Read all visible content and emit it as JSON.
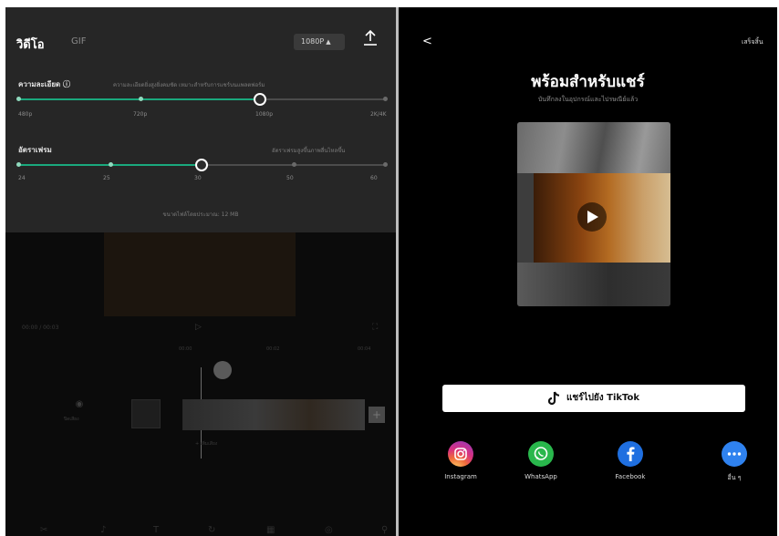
{
  "left": {
    "tabs": {
      "video": "วิดีโอ",
      "gif": "GIF"
    },
    "resolution_select": "1080P",
    "resolution_section": {
      "label": "ความละเอียด ⓘ",
      "hint": "ความละเอียดยิ่งสูงยิ่งคมชัด เหมาะสำหรับการแชร์บนแพลตฟอร์ม",
      "ticks": [
        "480p",
        "720p",
        "1080p",
        "2K/4K"
      ],
      "selected_fraction": 0.66
    },
    "framerate_section": {
      "label": "อัตราเฟรม",
      "hint": "อัตราเฟรมสูงขึ้นภาพลื่นไหลขึ้น",
      "ticks": [
        "24",
        "25",
        "30",
        "50",
        "60"
      ],
      "selected_fraction": 0.5
    },
    "size_note": "ขนาดไฟล์โดยประมาณ: 12 MB",
    "editor": {
      "time": "00:00 / 00:03",
      "ruler": [
        "00:00",
        "00:02",
        "00:04"
      ],
      "mute_label": "ปิดเสียง",
      "audio_label": "+ เพิ่มเสียง"
    }
  },
  "right": {
    "back": "<",
    "done": "เสร็จสิ้น",
    "title": "พร้อมสำหรับแชร์",
    "subtitle": "บันทึกลงในอุปกรณ์และไปรษณีย์แล้ว",
    "tiktok_button": "แชร์ไปยัง TikTok",
    "share_targets": [
      {
        "label": "Instagram",
        "icon": "instagram-icon",
        "color": "#d8317f"
      },
      {
        "label": "WhatsApp",
        "icon": "whatsapp-icon",
        "color": "#29b74c"
      },
      {
        "label": "Facebook",
        "icon": "facebook-icon",
        "color": "#1f6fe0"
      },
      {
        "label": "อื่น ๆ",
        "icon": "more-icon",
        "color": "#2f82ef"
      }
    ]
  },
  "colors": {
    "accent": "#1aa97d",
    "background": "#000000",
    "panel": "#262626"
  }
}
